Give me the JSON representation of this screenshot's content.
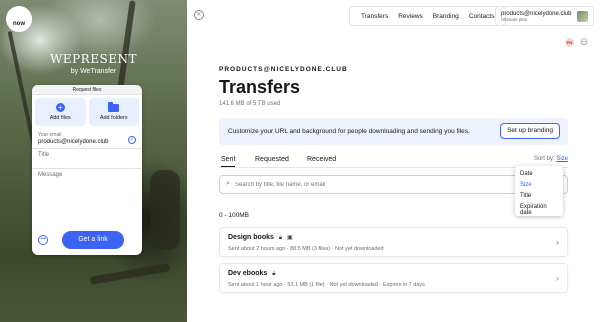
{
  "left_panel": {
    "logo_text": "now",
    "brand_title": "WEPRESENT",
    "brand_sub": "by WeTransfer",
    "upload_card": {
      "tab_label": "Request files",
      "add_files_label": "Add files",
      "add_folders_label": "Add folders",
      "email_label": "Your email",
      "email_value": "products@nicelydone.club",
      "title_placeholder": "Title",
      "message_placeholder": "Message",
      "options_icon": "ellipsis-icon",
      "submit_label": "Get a link"
    }
  },
  "header": {
    "nav": [
      "Transfers",
      "Reviews",
      "Branding",
      "Contacts"
    ],
    "account_email": "products@nicelydone.club",
    "account_plan": "Ultimate plan",
    "notif_initials": "PN"
  },
  "main": {
    "workspace": "PRODUCTS@NICELYDONE.CLUB",
    "title": "Transfers",
    "usage": "141.6 MB of 5 TB used",
    "banner_text": "Customize your URL and background for people downloading and sending you files.",
    "banner_button": "Set up branding",
    "tabs": [
      "Sent",
      "Requested",
      "Received"
    ],
    "sort_label": "Sort by:",
    "sort_value": "Size",
    "search_placeholder": "Search by title, file name, or email",
    "sort_options": [
      "Date",
      "Size",
      "Title",
      "Expiration date"
    ],
    "group_label": "0 - 100MB",
    "items": [
      {
        "title": "Design books",
        "meta": "Sent about 2 hours ago  ·  88.5 MB (3 files)  ·  Not yet downloaded"
      },
      {
        "title": "Dev ebooks",
        "meta": "Sent about 1 hour ago  ·  53.1 MB (1 file)  ·  Not yet downloaded  ·  Expires in 7 days"
      }
    ]
  },
  "colors": {
    "accent": "#3b64f5",
    "banner_bg": "#eef2fd"
  }
}
